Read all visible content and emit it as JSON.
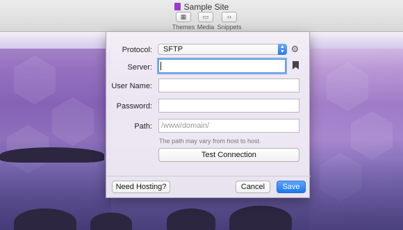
{
  "window": {
    "title": "Sample Site"
  },
  "toolbar": {
    "items": [
      {
        "label": "Themes",
        "icon": "themes-icon"
      },
      {
        "label": "Media",
        "icon": "media-icon"
      },
      {
        "label": "Snippets",
        "icon": "snippets-icon"
      }
    ]
  },
  "sheet": {
    "protocol": {
      "label": "Protocol:",
      "value": "SFTP",
      "options": [
        "SFTP"
      ]
    },
    "server": {
      "label": "Server:",
      "value": "",
      "placeholder": ""
    },
    "username": {
      "label": "User Name:",
      "value": ""
    },
    "password": {
      "label": "Password:",
      "value": ""
    },
    "path": {
      "label": "Path:",
      "value": "",
      "placeholder": "/www/domain/"
    },
    "hint": "The path may vary from host to host.",
    "test_connection": "Test Connection",
    "need_hosting": "Need Hosting?",
    "cancel": "Cancel",
    "save": "Save"
  },
  "colors": {
    "accent": "#1c76ef",
    "focus_ring": "#5b97e6",
    "title_icon": "#9a3ad0"
  }
}
